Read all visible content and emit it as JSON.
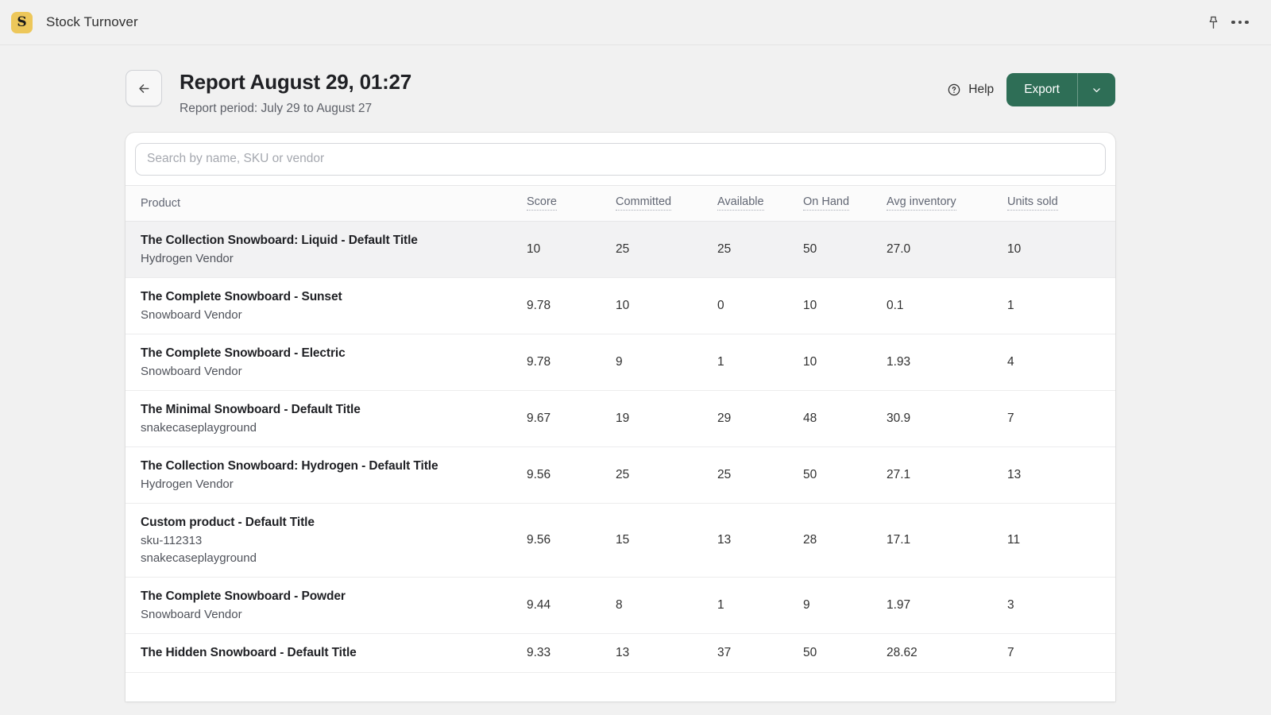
{
  "appbar": {
    "app_icon_letter": "S",
    "app_title": "Stock Turnover",
    "pin_icon": "pin-icon",
    "more_icon": "more-horizontal-icon"
  },
  "header": {
    "back_icon": "arrow-left-icon",
    "title": "Report August 29, 01:27",
    "subtitle": "Report period: July 29 to August 27",
    "help_label": "Help",
    "help_icon": "question-circle-icon",
    "export_label": "Export",
    "export_caret_icon": "chevron-down-icon",
    "export_color": "#2e6e56"
  },
  "search": {
    "placeholder": "Search by name, SKU or vendor",
    "value": ""
  },
  "table": {
    "columns": [
      {
        "key": "product",
        "label": "Product",
        "tooltip": false
      },
      {
        "key": "score",
        "label": "Score",
        "tooltip": true
      },
      {
        "key": "committed",
        "label": "Committed",
        "tooltip": true
      },
      {
        "key": "available",
        "label": "Available",
        "tooltip": true
      },
      {
        "key": "on_hand",
        "label": "On Hand",
        "tooltip": true
      },
      {
        "key": "avg_inventory",
        "label": "Avg inventory",
        "tooltip": true
      },
      {
        "key": "units_sold",
        "label": "Units sold",
        "tooltip": true
      }
    ],
    "rows": [
      {
        "name": "The Collection Snowboard: Liquid - Default Title",
        "sku": "",
        "vendor": "Hydrogen Vendor",
        "score": "10",
        "committed": "25",
        "available": "25",
        "on_hand": "50",
        "avg_inventory": "27.0",
        "units_sold": "10",
        "selected": true
      },
      {
        "name": "The Complete Snowboard - Sunset",
        "sku": "",
        "vendor": "Snowboard Vendor",
        "score": "9.78",
        "committed": "10",
        "available": "0",
        "on_hand": "10",
        "avg_inventory": "0.1",
        "units_sold": "1",
        "selected": false
      },
      {
        "name": "The Complete Snowboard - Electric",
        "sku": "",
        "vendor": "Snowboard Vendor",
        "score": "9.78",
        "committed": "9",
        "available": "1",
        "on_hand": "10",
        "avg_inventory": "1.93",
        "units_sold": "4",
        "selected": false
      },
      {
        "name": "The Minimal Snowboard - Default Title",
        "sku": "",
        "vendor": "snakecaseplayground",
        "score": "9.67",
        "committed": "19",
        "available": "29",
        "on_hand": "48",
        "avg_inventory": "30.9",
        "units_sold": "7",
        "selected": false
      },
      {
        "name": "The Collection Snowboard: Hydrogen - Default Title",
        "sku": "",
        "vendor": "Hydrogen Vendor",
        "score": "9.56",
        "committed": "25",
        "available": "25",
        "on_hand": "50",
        "avg_inventory": "27.1",
        "units_sold": "13",
        "selected": false
      },
      {
        "name": "Custom product - Default Title",
        "sku": "sku-112313",
        "vendor": "snakecaseplayground",
        "score": "9.56",
        "committed": "15",
        "available": "13",
        "on_hand": "28",
        "avg_inventory": "17.1",
        "units_sold": "11",
        "selected": false
      },
      {
        "name": "The Complete Snowboard - Powder",
        "sku": "",
        "vendor": "Snowboard Vendor",
        "score": "9.44",
        "committed": "8",
        "available": "1",
        "on_hand": "9",
        "avg_inventory": "1.97",
        "units_sold": "3",
        "selected": false
      },
      {
        "name": "The Hidden Snowboard - Default Title",
        "sku": "",
        "vendor": "",
        "score": "9.33",
        "committed": "13",
        "available": "37",
        "on_hand": "50",
        "avg_inventory": "28.62",
        "units_sold": "7",
        "selected": false
      }
    ]
  }
}
